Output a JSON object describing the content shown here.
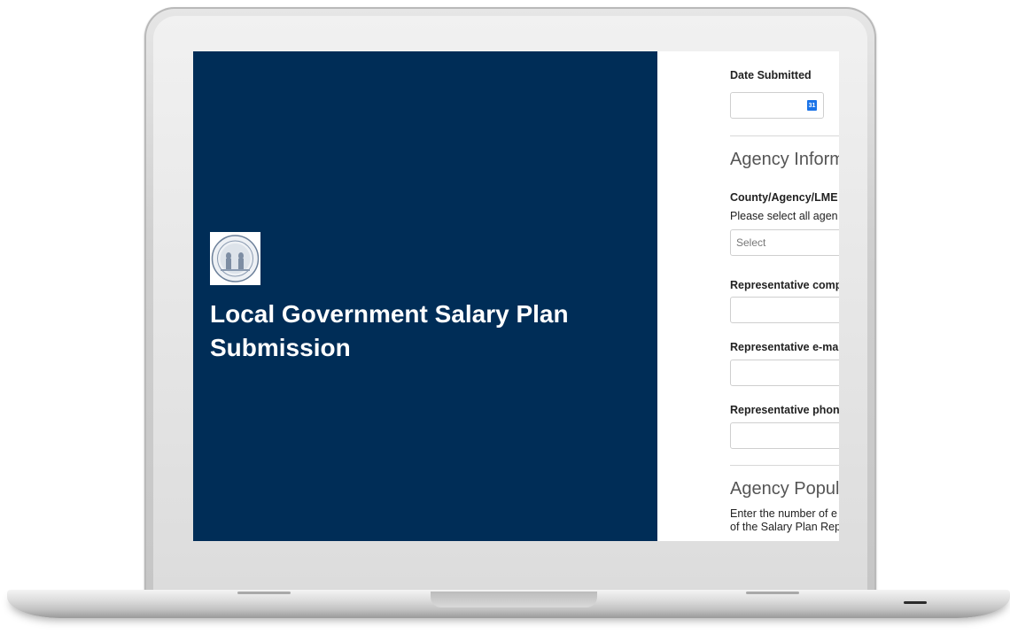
{
  "hero": {
    "title": "Local Government Salary Plan Submission",
    "seal_icon": "nc-state-seal-icon",
    "background": "#002d57"
  },
  "form": {
    "date_submitted_label": "Date Submitted",
    "date_value": "",
    "calendar_icon": "calendar-icon",
    "calendar_icon_text": "31",
    "agency_section_title": "Agency Informa",
    "county_label": "County/Agency/LME",
    "county_hint": "Please select all agen",
    "county_select_placeholder": "Select",
    "rep_company_label": "Representative comp",
    "rep_company_value": "",
    "rep_email_label": "Representative e-mai",
    "rep_email_value": "",
    "rep_phone_label": "Representative phone",
    "rep_phone_value": "",
    "population_section_title": "Agency Populat",
    "population_hint_line1": "Enter the number of e",
    "population_hint_line2": "of the Salary Plan Rep"
  }
}
